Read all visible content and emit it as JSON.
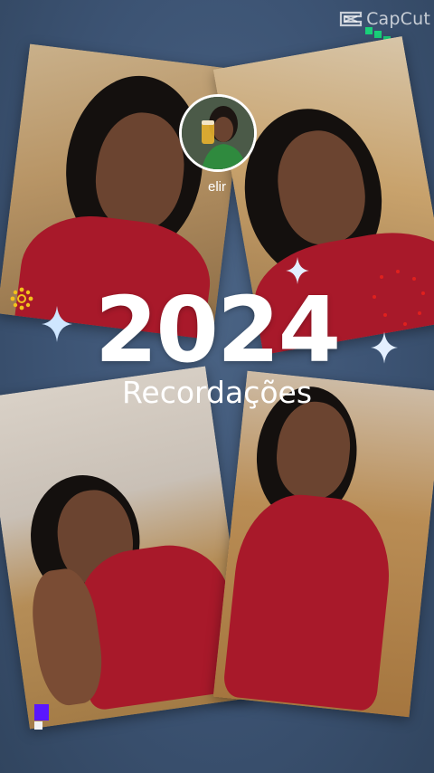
{
  "watermark": {
    "label": "CapCut",
    "icon": "capcut-logo-icon"
  },
  "profile": {
    "name": "elir"
  },
  "title": {
    "year": "2024",
    "subtitle": "Recordações"
  },
  "colors": {
    "accent_green": "#19d17a",
    "accent_purple": "#5a16ff",
    "dress_red": "#a8192a",
    "background": "#3c5373"
  }
}
